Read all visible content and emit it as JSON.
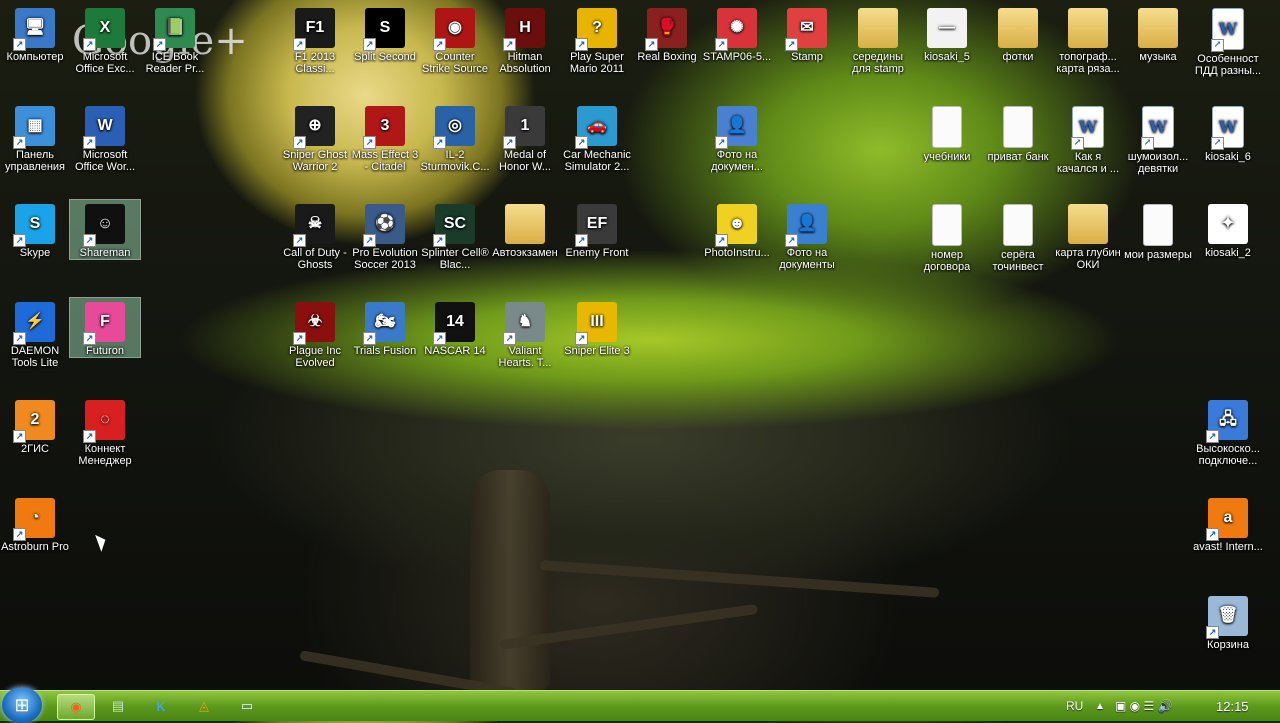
{
  "watermark": "Google+",
  "icons": [
    {
      "label": "Компьютер",
      "bg": "#3a78c8",
      "glyph": "🖥"
    },
    {
      "label": "Microsoft Office Exc...",
      "bg": "#1d7a3a",
      "glyph": "X"
    },
    {
      "label": "ICE Book Reader Pr...",
      "bg": "#2f8a4f",
      "glyph": "📗"
    },
    {
      "label": "F1 2013 Classi...",
      "bg": "#1a1a1a",
      "glyph": "F1"
    },
    {
      "label": "Split Second",
      "bg": "#000000",
      "glyph": "S"
    },
    {
      "label": "Counter Strike Source",
      "bg": "#b01515",
      "glyph": "◉"
    },
    {
      "label": "Hitman Absolution",
      "bg": "#6b0e0e",
      "glyph": "H"
    },
    {
      "label": "Play Super Mario 2011",
      "bg": "#e8b400",
      "glyph": "?"
    },
    {
      "label": "Real Boxing",
      "bg": "#8a2020",
      "glyph": "🥊"
    },
    {
      "label": "STAMP06-5...",
      "bg": "#d8323a",
      "glyph": "✺"
    },
    {
      "label": "Stamp",
      "bg": "#e04040",
      "glyph": "✉"
    },
    {
      "label": "середины для stamp",
      "bg": "#e0b850",
      "glyph": ""
    },
    {
      "label": "kiosaki_5",
      "bg": "#f2f2f2",
      "glyph": "—"
    },
    {
      "label": "фотки",
      "bg": "#c8a040",
      "glyph": ""
    },
    {
      "label": "топограф... карта ряза...",
      "bg": "#d9b050",
      "glyph": ""
    },
    {
      "label": "музыка",
      "bg": "#c89840",
      "glyph": ""
    },
    {
      "label": "Особенност ПДД разны...",
      "bg": "#ffffff",
      "glyph": "W"
    },
    {
      "label": "Панель управления",
      "bg": "#3c8fd8",
      "glyph": "▦"
    },
    {
      "label": "Microsoft Office Wor...",
      "bg": "#2b5fb5",
      "glyph": "W"
    },
    {
      "label": "Sniper Ghost Warrior 2",
      "bg": "#222222",
      "glyph": "⊕"
    },
    {
      "label": "Mass Effect 3 - Citadel",
      "bg": "#b01818",
      "glyph": "3"
    },
    {
      "label": "IL-2 Sturmovik.C...",
      "bg": "#2a62a8",
      "glyph": "◎"
    },
    {
      "label": "Medal of Honor W...",
      "bg": "#3a3a3a",
      "glyph": "1"
    },
    {
      "label": "Car Mechanic Simulator 2...",
      "bg": "#2a9ad0",
      "glyph": "🚗"
    },
    {
      "label": "Фото на докумен...",
      "bg": "#4a80d0",
      "glyph": "👤"
    },
    {
      "label": "учебники",
      "bg": "#ffffff",
      "glyph": ""
    },
    {
      "label": "приват банк",
      "bg": "#ffffff",
      "glyph": ""
    },
    {
      "label": "Как я качался и ...",
      "bg": "#ffffff",
      "glyph": "W"
    },
    {
      "label": "шумоизол... девятки",
      "bg": "#ffffff",
      "glyph": "W"
    },
    {
      "label": "kiosaki_6",
      "bg": "#ffffff",
      "glyph": "W"
    },
    {
      "label": "Skype",
      "bg": "#1aa3e8",
      "glyph": "S"
    },
    {
      "label": "Shareman",
      "bg": "#101010",
      "glyph": "☺"
    },
    {
      "label": "Call of Duty - Ghosts",
      "bg": "#1a1a1a",
      "glyph": "☠"
    },
    {
      "label": "Pro Evolution Soccer 2013",
      "bg": "#3a5a8a",
      "glyph": "⚽"
    },
    {
      "label": "Splinter Cell® Blac...",
      "bg": "#1a3a2a",
      "glyph": "SC"
    },
    {
      "label": "Автоэкзамен",
      "bg": "#e0b850",
      "glyph": ""
    },
    {
      "label": "Enemy Front",
      "bg": "#3a3a3a",
      "glyph": "EF"
    },
    {
      "label": "PhotoInstru...",
      "bg": "#f0d020",
      "glyph": "☻"
    },
    {
      "label": "Фото на документы",
      "bg": "#3a80d0",
      "glyph": "👤"
    },
    {
      "label": "номер договора",
      "bg": "#ffffff",
      "glyph": ""
    },
    {
      "label": "серёга точинвест",
      "bg": "#ffffff",
      "glyph": ""
    },
    {
      "label": "карта глубин ОКИ",
      "bg": "#d9b050",
      "glyph": ""
    },
    {
      "label": "мои размеры",
      "bg": "#ffffff",
      "glyph": ""
    },
    {
      "label": "kiosaki_2",
      "bg": "#ffffff",
      "glyph": "✦"
    },
    {
      "label": "DAEMON Tools Lite",
      "bg": "#1d6ad8",
      "glyph": "⚡"
    },
    {
      "label": "Futuron",
      "bg": "#e84a9a",
      "glyph": "F"
    },
    {
      "label": "Plague Inc Evolved",
      "bg": "#8a1010",
      "glyph": "☣"
    },
    {
      "label": "Trials Fusion",
      "bg": "#3a7ac8",
      "glyph": "🏍"
    },
    {
      "label": "NASCAR 14",
      "bg": "#111111",
      "glyph": "14"
    },
    {
      "label": "Valiant Hearts. T...",
      "bg": "#7a8a8a",
      "glyph": "♞"
    },
    {
      "label": "Sniper Elite 3",
      "bg": "#e8b800",
      "glyph": "III"
    },
    {
      "label": "2ГИС",
      "bg": "#f08a20",
      "glyph": "2"
    },
    {
      "label": "Коннект Менеджер",
      "bg": "#d82020",
      "glyph": "◌"
    },
    {
      "label": "Высокоско... подключе...",
      "bg": "#3a7ad8",
      "glyph": "🖧"
    },
    {
      "label": "Astroburn Pro",
      "bg": "#f07a10",
      "glyph": "◔"
    },
    {
      "label": "avast! Intern...",
      "bg": "#f07a10",
      "glyph": "a"
    },
    {
      "label": "Корзина",
      "bg": "#9ab8d8",
      "glyph": "🗑"
    }
  ],
  "taskbar": {
    "items": [
      {
        "name": "firefox",
        "glyph": "◉",
        "color": "#f06020"
      },
      {
        "name": "notepad",
        "glyph": "▤",
        "color": "#cde"
      },
      {
        "name": "k-app",
        "glyph": "K",
        "color": "#4af"
      },
      {
        "name": "avast",
        "glyph": "◬",
        "color": "#f90"
      },
      {
        "name": "window",
        "glyph": "▭",
        "color": "#dfe"
      }
    ],
    "lang": "RU",
    "time": "12:15"
  }
}
